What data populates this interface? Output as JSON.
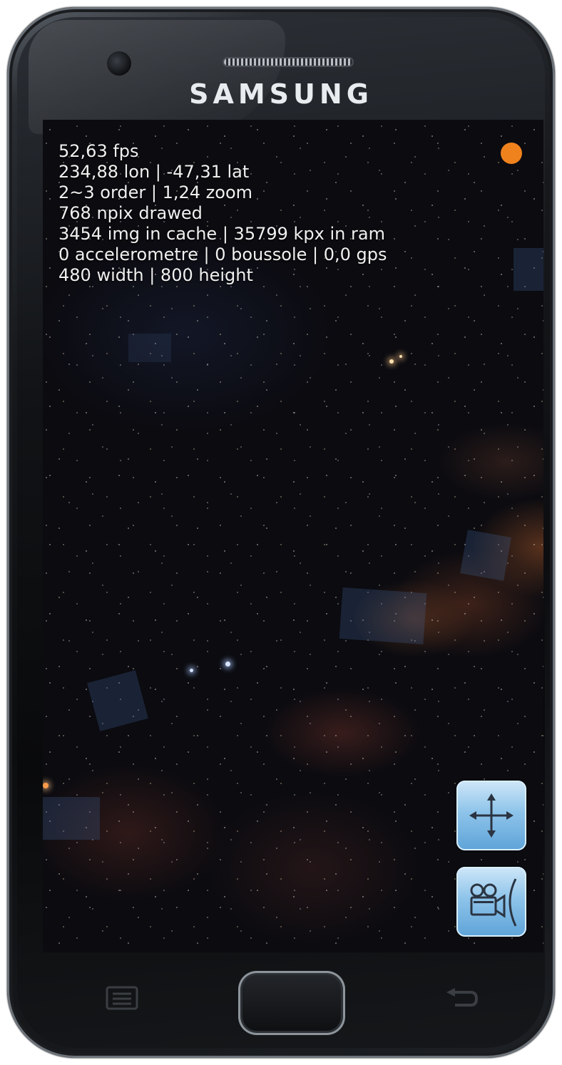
{
  "device": {
    "brand": "SAMSUNG"
  },
  "debug_overlay": {
    "lines": [
      "52,63 fps",
      "234,88 lon | -47,31 lat",
      "2~3 order | 1,24 zoom",
      "768 npix drawed",
      "3454 img in cache | 35799 kpx in ram",
      "0 accelerometre | 0 boussole | 0,0  gps",
      "480 width | 800 height"
    ]
  },
  "status_indicator": {
    "color": "#f0821d"
  },
  "controls": {
    "pan_button": {
      "icon": "move-arrows-icon"
    },
    "camera_button": {
      "icon": "video-camera-icon"
    }
  },
  "hardware_keys": {
    "menu": {
      "icon": "menu-icon"
    },
    "home": {
      "icon": "home-key"
    },
    "back": {
      "icon": "back-icon"
    }
  }
}
